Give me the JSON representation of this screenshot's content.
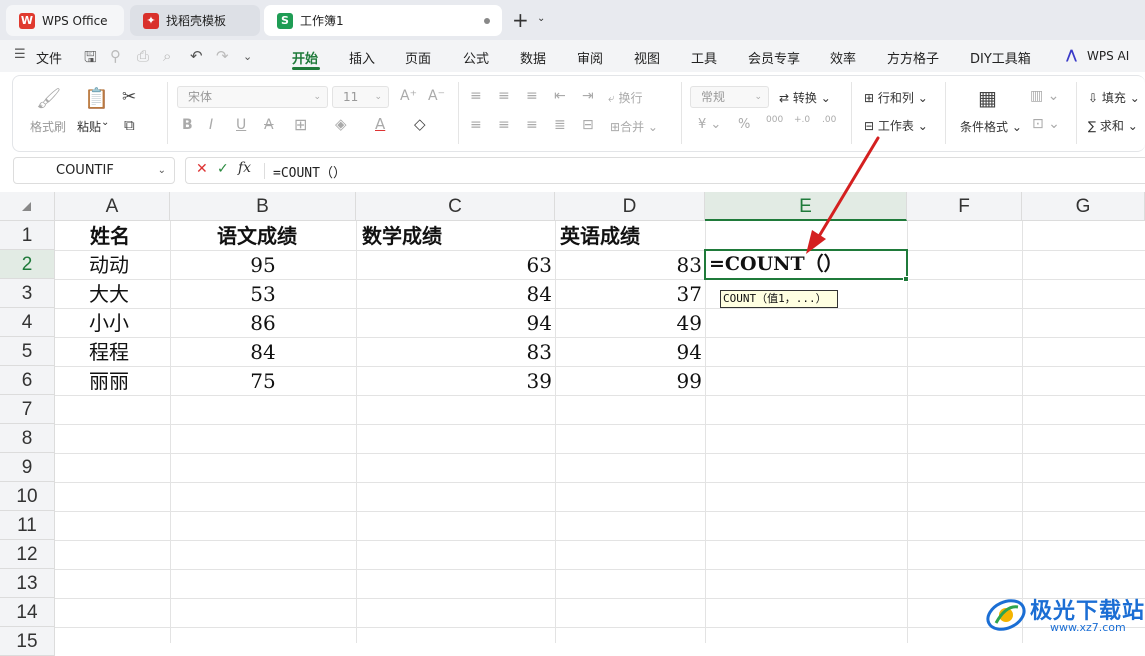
{
  "tabs": [
    {
      "label": "WPS Office",
      "icon": "wps-logo-icon",
      "color": "#e03a2f"
    },
    {
      "label": "找稻壳模板",
      "icon": "docer-icon",
      "color": "#d9302b"
    },
    {
      "label": "工作簿1",
      "icon": "spreadsheet-icon",
      "icon_text": "S",
      "color": "#1f9d55"
    }
  ],
  "menu": {
    "file": "文件",
    "items": [
      "开始",
      "插入",
      "页面",
      "公式",
      "数据",
      "审阅",
      "视图",
      "工具",
      "会员专享",
      "效率",
      "方方格子",
      "DIY工具箱"
    ],
    "active": "开始",
    "ai": "WPS AI"
  },
  "ribbon": {
    "format_painter": "格式刷",
    "paste": "粘贴",
    "font_name": "宋体",
    "font_size": "11",
    "wrap": "换行",
    "merge": "合并",
    "number_format": "常规",
    "convert": "转换",
    "row_col": "行和列",
    "worksheet": "工作表",
    "cond_format": "条件格式",
    "fill": "填充",
    "sum": "求和"
  },
  "name_box": "COUNTIF",
  "formula": "=COUNT（）",
  "columns": [
    "A",
    "B",
    "C",
    "D",
    "E",
    "F",
    "G"
  ],
  "selected_column": "E",
  "rows": [
    "1",
    "2",
    "3",
    "4",
    "5",
    "6",
    "7",
    "8",
    "9",
    "10",
    "11",
    "12",
    "13",
    "14",
    "15"
  ],
  "selected_row": "2",
  "sheet": {
    "headers": [
      "姓名",
      "语文成绩",
      "数学成绩",
      "英语成绩"
    ],
    "data": [
      [
        "动动",
        "95",
        "63",
        "83"
      ],
      [
        "大大",
        "53",
        "84",
        "37"
      ],
      [
        "小小",
        "86",
        "94",
        "49"
      ],
      [
        "程程",
        "84",
        "83",
        "94"
      ],
      [
        "丽丽",
        "75",
        "39",
        "99"
      ]
    ]
  },
  "edit_cell": "=COUNT（）",
  "tooltip": "COUNT（值1，...）",
  "watermark": {
    "title": "极光下载站",
    "url": "www.xz7.com"
  },
  "accent": "#1f7a3a",
  "arrow_color": "#d42020"
}
